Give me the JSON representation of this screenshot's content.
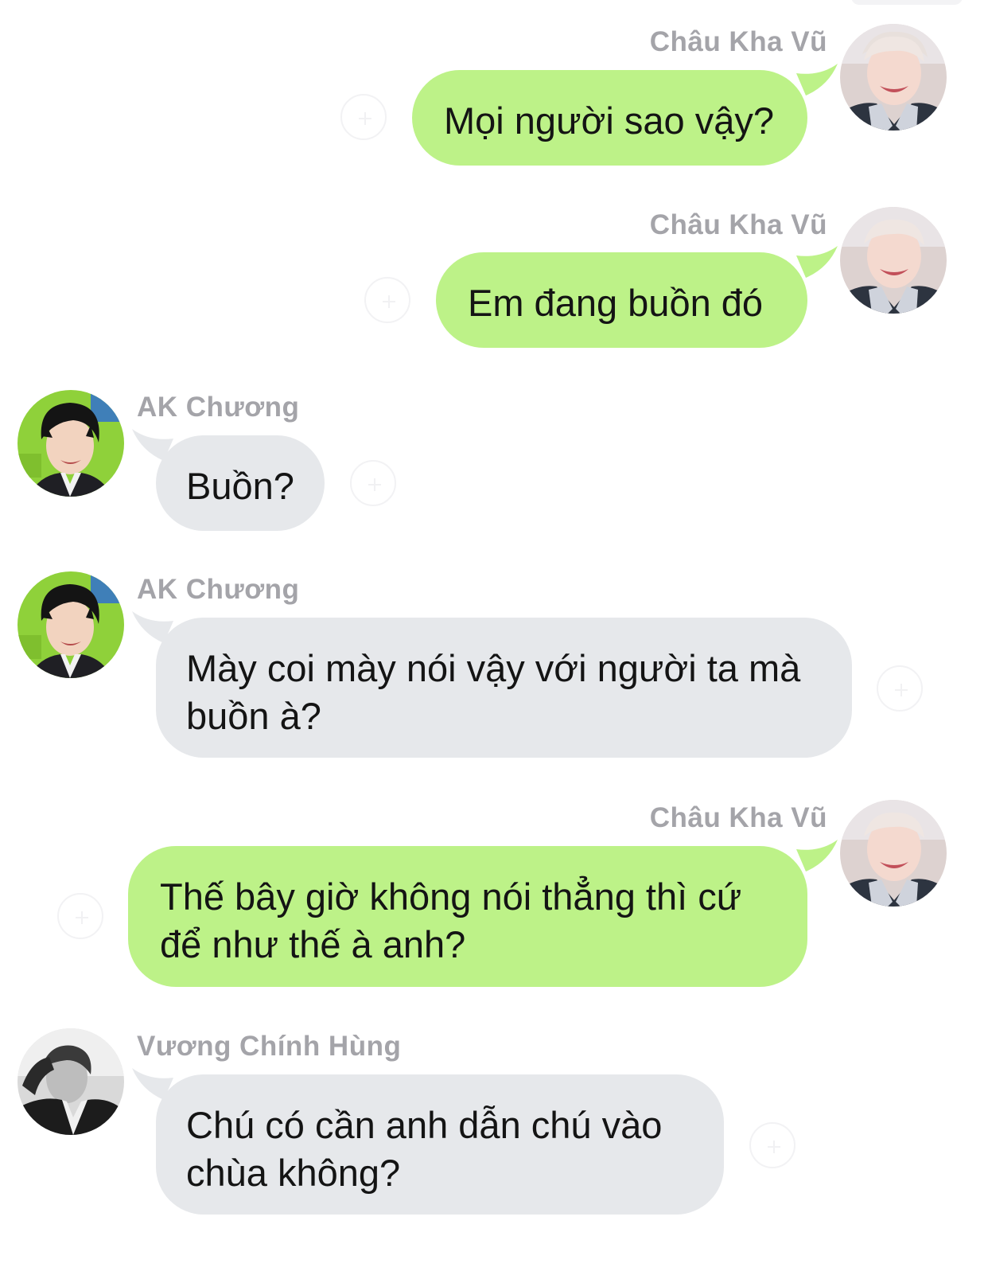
{
  "messages": [
    {
      "sender": "Châu Kha Vũ",
      "text": "Mọi người sao vậy?",
      "side": "right"
    },
    {
      "sender": "Châu Kha Vũ",
      "text": "Em đang buồn đó",
      "side": "right"
    },
    {
      "sender": "AK Chương",
      "text": "Buồn?",
      "side": "left"
    },
    {
      "sender": "AK Chương",
      "text": "Mày coi mày nói vậy với người ta mà buồn à?",
      "side": "left"
    },
    {
      "sender": "Châu Kha Vũ",
      "text": "Thế bây giờ không nói thẳng thì cứ để như thế à anh?",
      "side": "right"
    },
    {
      "sender": "Vương Chính Hùng",
      "text": "Chú có cần anh dẫn chú vào chùa không?",
      "side": "left"
    }
  ],
  "colors": {
    "outgoing_bubble": "#bdf288",
    "incoming_bubble": "#e6e8eb",
    "sender_name": "#a4a4a9",
    "message_text": "#141414"
  },
  "icons": {
    "avatar_chau_kha_vu": "avatar",
    "avatar_ak_chuong": "avatar",
    "avatar_vuong_chinh_hung": "avatar",
    "reaction": "add-reaction-icon"
  }
}
